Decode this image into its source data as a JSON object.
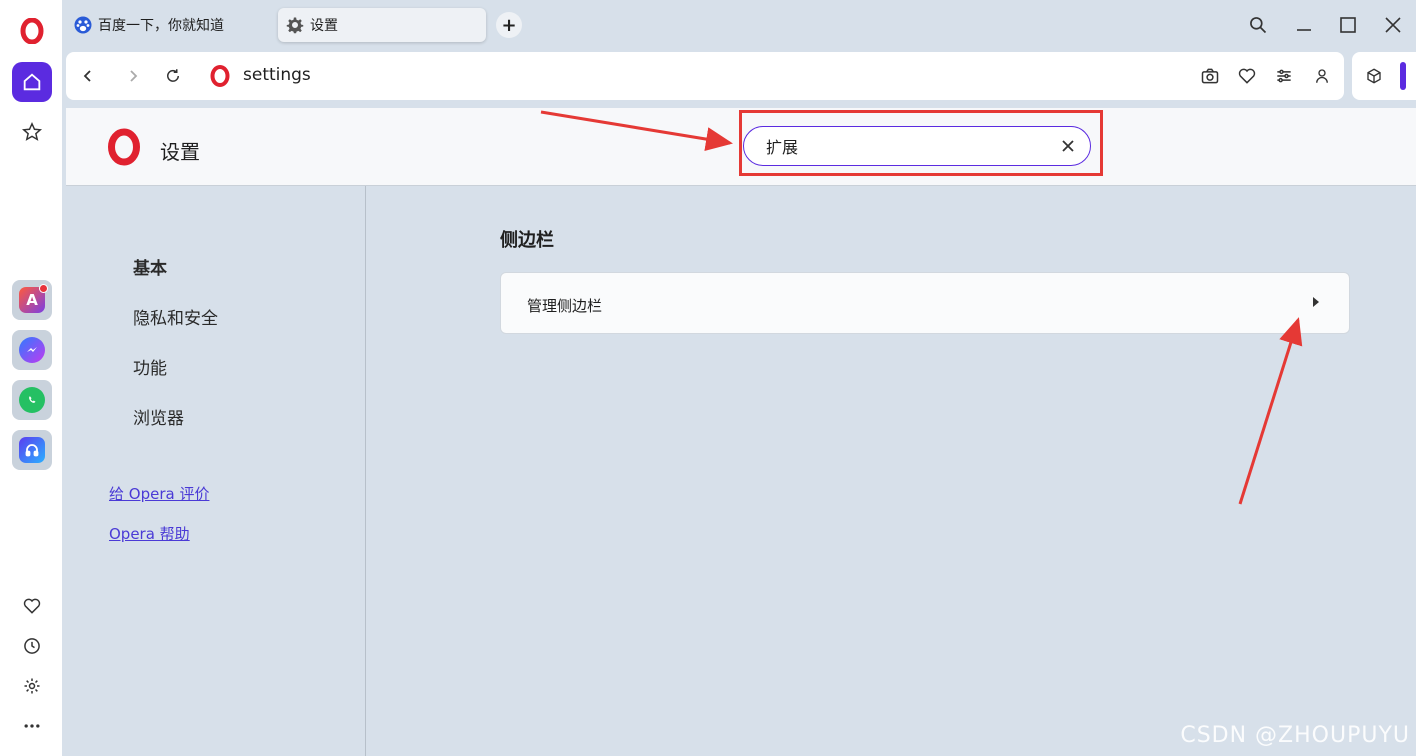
{
  "tabs": [
    {
      "label": "百度一下，你就知道",
      "icon": "baidu-icon"
    },
    {
      "label": "设置",
      "icon": "gear-icon"
    }
  ],
  "address": {
    "url": "settings"
  },
  "settings": {
    "title": "设置",
    "search_value": "扩展",
    "nav": [
      "基本",
      "隐私和安全",
      "功能",
      "浏览器"
    ],
    "links": [
      "给 Opera 评价",
      "Opera 帮助"
    ],
    "section_title": "侧边栏",
    "card_label": "管理侧边栏"
  },
  "watermark": "CSDN @ZHOUPUYU",
  "colors": {
    "accent": "#5b2be0",
    "annotation": "#e53935",
    "opera_red": "#e0212f"
  }
}
